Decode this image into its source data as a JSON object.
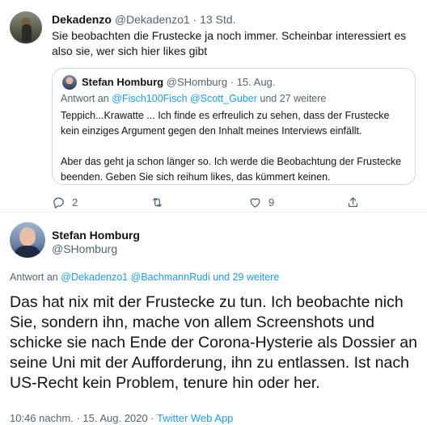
{
  "tweet1": {
    "author_name": "Dekadenzo",
    "author_handle": "@Dekadenzo1",
    "separator": "·",
    "time": "13 Std.",
    "text": "Sie beobachten die Frustecke ja noch immer. Scheinbar interessiert es also sie, wer sich hier likes gibt",
    "reply_count": "2",
    "like_count": "9"
  },
  "quoted": {
    "author_name": "Stefan Homburg",
    "author_handle": "@SHomburg",
    "separator": "·",
    "time": "15. Aug.",
    "reply_prefix": "Antwort an",
    "reply_mention1": "@Fisch100Fisch",
    "reply_mention2": "@Scott_Guber",
    "reply_suffix": "und 27 weitere",
    "paragraph1": "Teppich...Krawatte ... Ich finde es erfreulich zu sehen, dass der Frustecke kein einziges Argument gegen den Inhalt meines Interviews einfällt.",
    "paragraph2": "Aber das geht  ja schon länger so. Ich werde die Beobachtung der Frustecke beenden. Geben Sie sich reihum likes, das kümmert keinen."
  },
  "tweet2": {
    "author_name": "Stefan Homburg",
    "author_handle": "@SHomburg",
    "reply_prefix": "Antwort an",
    "reply_mention1": "@Dekadenzo1",
    "reply_mention2": "@BachmannRudi",
    "reply_suffix": "und 29 weitere",
    "text": "Das hat nix mit der Frustecke zu tun. Ich beobachte nich Sie, sondern ihn, mache von allem Screenshots und schicke sie nach Ende der Corona-Hysterie als Dossier an seine Uni mit der Aufforderung, ihn zu entlassen. Ist nach US-Recht kein Problem, tenure hin oder her.",
    "time": "10:46 nachm.",
    "separator": "·",
    "date": "15. Aug. 2020",
    "separator2": "·",
    "source": "Twitter Web App"
  },
  "colors": {
    "link": "#1d9bf0",
    "muted": "#536471",
    "text": "#0f1419",
    "border": "#cfd9de"
  },
  "icons": [
    "reply-icon",
    "retweet-icon",
    "like-icon",
    "share-icon"
  ]
}
